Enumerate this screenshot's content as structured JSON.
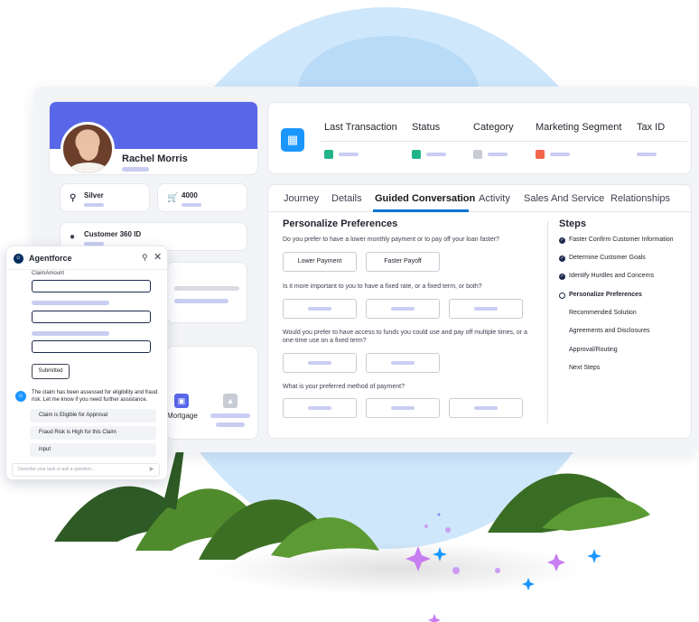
{
  "profile": {
    "name": "Rachel Morris",
    "tier_label": "Silver",
    "points_label": "4000",
    "customer_id_label": "Customer 360 ID"
  },
  "header": {
    "columns": [
      "Last Transaction",
      "Status",
      "Category",
      "Marketing Segment",
      "Tax ID"
    ]
  },
  "tabs": [
    "Journey",
    "Details",
    "Guided Conversation",
    "Activity",
    "Sales And Service",
    "Relationships"
  ],
  "active_tab": "Guided Conversation",
  "conversation": {
    "title": "Personalize Preferences",
    "questions": [
      "Do you prefer to have a lower monthly payment or to pay off your loan faster?",
      "Is it more important to you to have a fixed rate, or a fixed term, or both?",
      "Would you prefer to have access to funds you could use and pay off multiple times, or a one-time use on a fixed term?",
      "What is your preferred method of payment?"
    ],
    "q1_options": [
      "Lower Payment",
      "Faster Payoff"
    ]
  },
  "steps": {
    "title": "Steps",
    "items": [
      {
        "label": "Faster Confirm Customer Information",
        "state": "done"
      },
      {
        "label": "Determine Customer Goals",
        "state": "done"
      },
      {
        "label": "Identify Hurdles and Concerns",
        "state": "done"
      },
      {
        "label": "Personalize Preferences",
        "state": "current"
      },
      {
        "label": "Recommended Solution",
        "state": "todo"
      },
      {
        "label": "Agreements and Disclosures",
        "state": "todo"
      },
      {
        "label": "Approval/Routing",
        "state": "todo"
      },
      {
        "label": "Next Steps",
        "state": "todo"
      }
    ]
  },
  "mortgage": {
    "label": "Mortgage"
  },
  "agent": {
    "title": "Agentforce",
    "field_label": "ClaimAmount",
    "submitted_label": "Submitted",
    "bot_message": "The claim has been assessed for eligibility and fraud risk. Let me know if you need further assistance.",
    "chips": [
      "Claim is Eligible for Approval",
      "Fraud Risk is High for this Claim",
      "input"
    ],
    "input_placeholder": "Describe your task or ask a question..."
  },
  "colors": {
    "brand_blue": "#1b96ff",
    "profile_band": "#5867e8",
    "tab_accent": "#0176d3",
    "step_dot": "#1e2a4e"
  }
}
